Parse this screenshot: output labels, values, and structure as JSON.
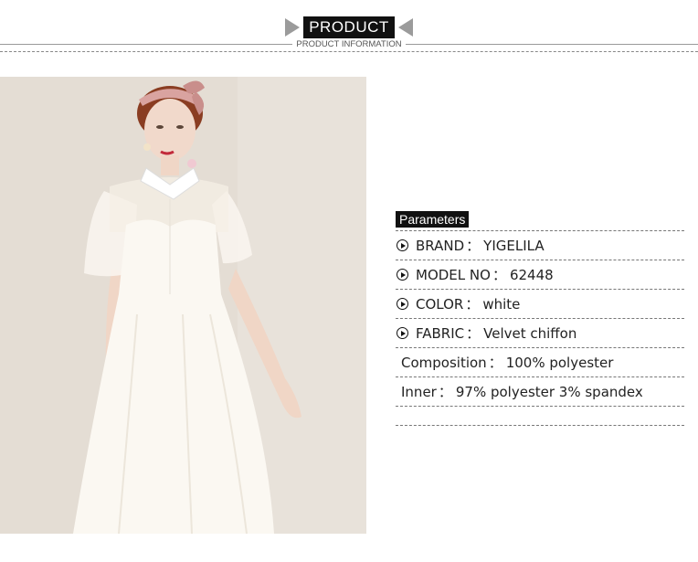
{
  "header": {
    "title": "PRODUCT",
    "subtitle": "PRODUCT INFORMATION"
  },
  "product_image": {
    "icon": "model-photo",
    "description_colors": {
      "background": "#e4ddd4",
      "dress": "#fbf8f2",
      "headband": "#d9a3a0"
    }
  },
  "parameters": {
    "title": "Parameters",
    "rows": [
      {
        "label": "BRAND",
        "sep": "：",
        "value": "YIGELILA"
      },
      {
        "label": "MODEL NO",
        "sep": "：",
        "value": "62448"
      },
      {
        "label": "COLOR",
        "sep": "：",
        "value": "white"
      },
      {
        "label": "FABRIC",
        "sep": "：",
        "value": "Velvet chiffon"
      },
      {
        "label": "Composition",
        "sep": "：",
        "value": "100% polyester"
      },
      {
        "label": "Inner",
        "sep": "：",
        "value": "97% polyester 3% spandex"
      }
    ]
  }
}
